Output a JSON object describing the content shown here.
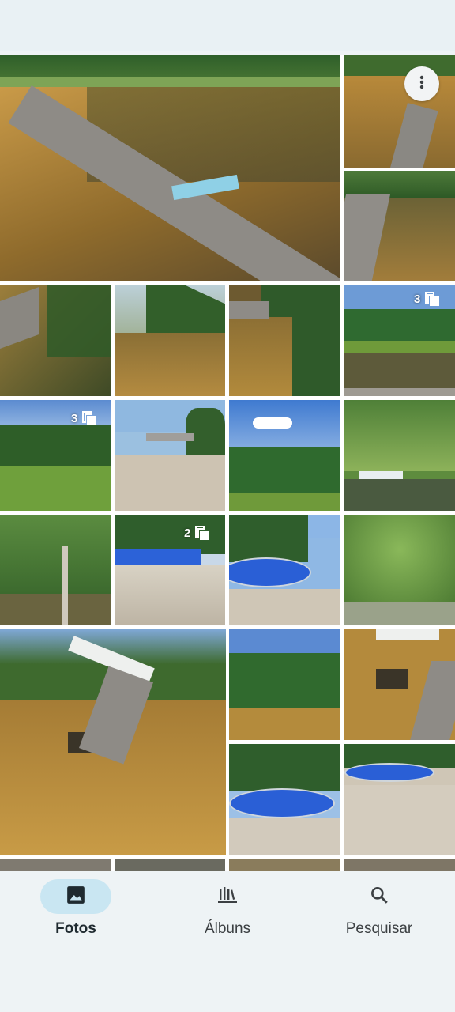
{
  "grid": {
    "badges": [
      {
        "count": "3"
      },
      {
        "count": "3"
      },
      {
        "count": "2"
      }
    ]
  },
  "toolbar": {
    "more_icon": "more-vert-icon"
  },
  "nav": {
    "items": [
      {
        "label": "Fotos",
        "icon": "photo-icon",
        "active": true
      },
      {
        "label": "Álbuns",
        "icon": "library-icon",
        "active": false
      },
      {
        "label": "Pesquisar",
        "icon": "search-icon",
        "active": false
      }
    ]
  },
  "colors": {
    "accent_pill": "#c9e6f2",
    "background": "#eef3f5",
    "pool_blue": "#2a5fd6",
    "water_amber": "#a67c2e"
  }
}
